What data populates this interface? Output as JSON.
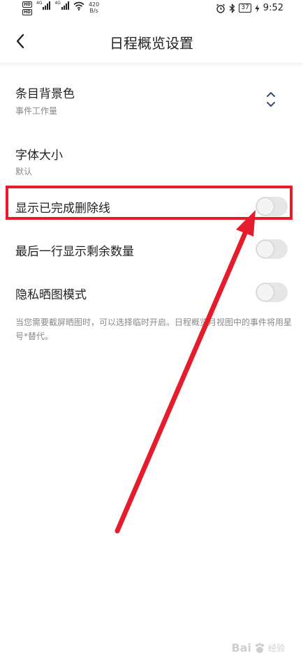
{
  "status_bar": {
    "hd1": "HD",
    "hd2": "HD",
    "net1": "4G",
    "net2": "4G",
    "speed_value": "420",
    "speed_unit": "B/s",
    "battery": "37",
    "time": "9:52"
  },
  "header": {
    "title": "日程概览设置"
  },
  "settings": {
    "bg_color_label": "条目背景色",
    "bg_color_value": "事件工作量",
    "font_size_label": "字体大小",
    "font_size_value": "默认",
    "strike_label": "显示已完成删除线",
    "last_row_label": "最后一行显示剩余数量",
    "privacy_label": "隐私晒图模式",
    "privacy_note": "当您需要截屏晒图时，可以选择临时开启。日程概览月视图中的事件将用星号*替代。"
  },
  "toggles": {
    "strike": "off",
    "last_row": "off",
    "privacy": "off"
  },
  "annotation": {
    "color": "#e41c2b"
  },
  "watermark": {
    "brand": "Bai",
    "sub": "经验"
  }
}
